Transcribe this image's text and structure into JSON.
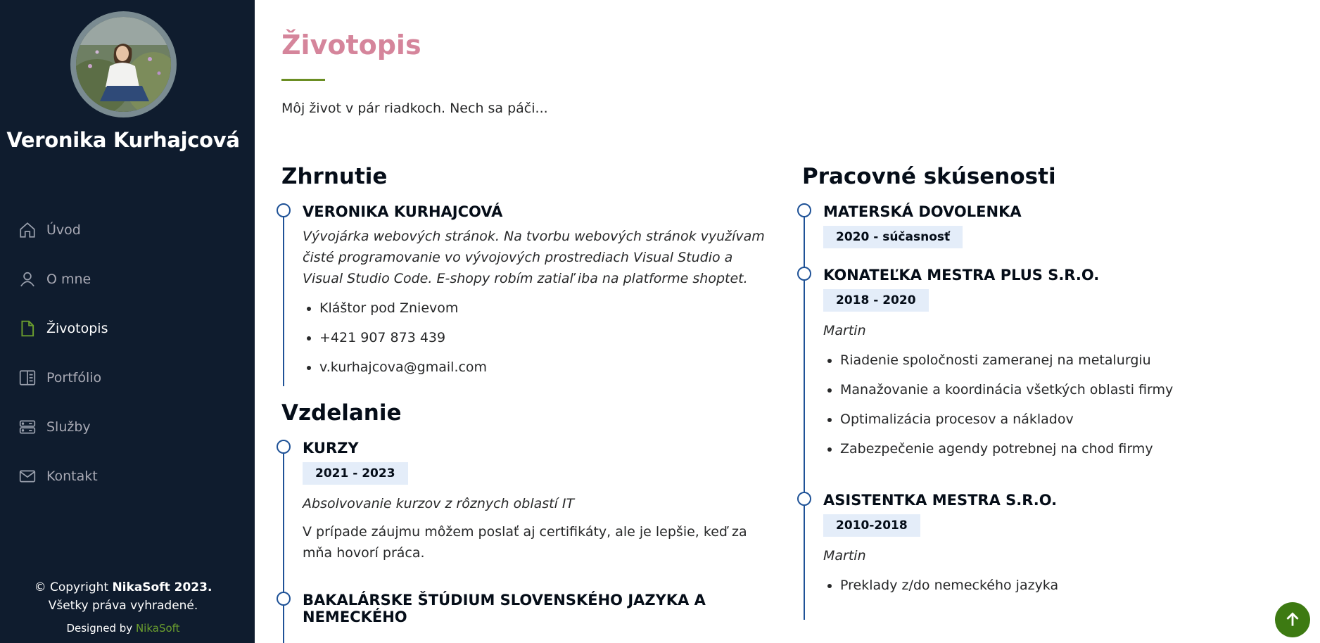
{
  "profile": {
    "name": "Veronika Kurhajcová"
  },
  "nav": {
    "items": [
      {
        "label": "Úvod",
        "icon": "home-icon"
      },
      {
        "label": "O mne",
        "icon": "person-icon"
      },
      {
        "label": "Životopis",
        "icon": "file-icon",
        "active": true
      },
      {
        "label": "Portfólio",
        "icon": "book-icon"
      },
      {
        "label": "Služby",
        "icon": "server-icon"
      },
      {
        "label": "Kontakt",
        "icon": "envelope-icon"
      }
    ]
  },
  "footer": {
    "copyright_prefix": "© Copyright ",
    "copyright_brand": "NikaSoft 2023.",
    "rights": "Všetky práva vyhradené.",
    "designed_by": "Designed by ",
    "designer": "NikaSoft"
  },
  "page": {
    "title": "Životopis",
    "intro": "Môj život v pár riadkoch. Nech sa páči..."
  },
  "summary": {
    "heading": "Zhrnutie",
    "name": "VERONIKA KURHAJCOVÁ",
    "description": "Vývojárka webových stránok. Na tvorbu webových stránok využívam čisté programovanie vo vývojových prostrediach Visual Studio a Visual Studio Code. E-shopy robím zatiaľ iba na platforme shoptet.",
    "contacts": [
      "Kláštor pod Znievom",
      "+421 907 873 439",
      "v.kurhajcova@gmail.com"
    ]
  },
  "education": {
    "heading": "Vzdelanie",
    "items": [
      {
        "title": "KURZY",
        "date": "2021 - 2023",
        "italic": "Absolvovanie kurzov z rôznych oblastí IT",
        "text": "V prípade záujmu môžem poslať aj certifikáty, ale je lepšie, keď za mňa hovorí práca."
      },
      {
        "title": "BAKALÁRSKE ŠTÚDIUM SLOVENSKÉHO JAZYKA A NEMECKÉHO"
      }
    ]
  },
  "experience": {
    "heading": "Pracovné skúsenosti",
    "items": [
      {
        "title": "MATERSKÁ DOVOLENKA",
        "date": "2020 - súčasnosť"
      },
      {
        "title": "KONATEĽKA MESTRA PLUS S.R.O.",
        "date": "2018 - 2020",
        "place": "Martin",
        "bullets": [
          "Riadenie spoločnosti zameranej na metalurgiu",
          "Manažovanie a koordinácia všetkých oblasti firmy",
          "Optimalizácia procesov a nákladov",
          "Zabezpečenie agendy potrebnej na chod firmy"
        ]
      },
      {
        "title": "ASISTENTKA MESTRA S.R.O.",
        "date": "2010-2018",
        "place": "Martin",
        "bullets": [
          "Preklady z/do nemeckého jazyka"
        ]
      }
    ]
  },
  "colors": {
    "sidebar_bg": "#0f1c2e",
    "title_pink": "#d5859b",
    "accent_green": "#6b8e23",
    "timeline_blue": "#1f5297",
    "date_badge_bg": "#e4edf9",
    "scroll_top_bg": "#3d7a12"
  }
}
